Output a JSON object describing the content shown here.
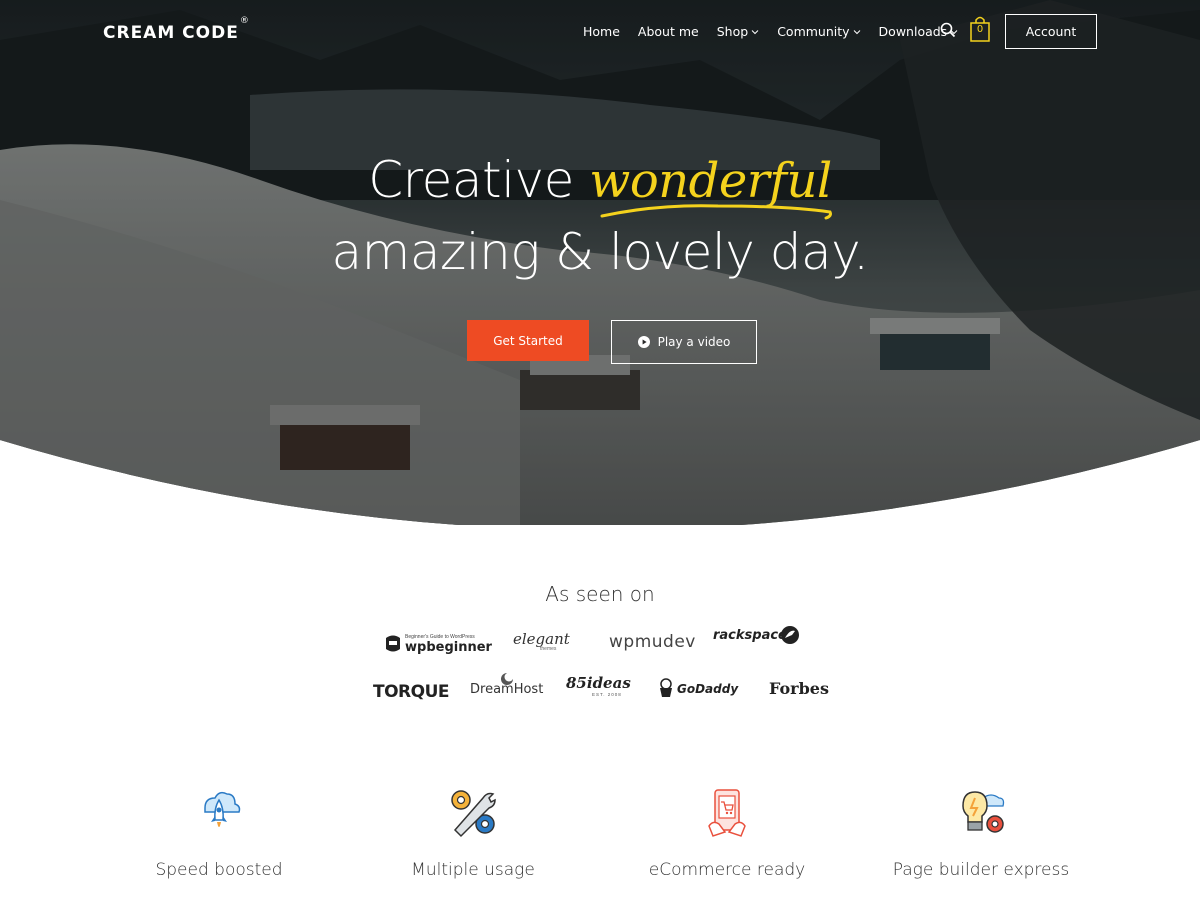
{
  "nav": {
    "logo": "CREAM CODE",
    "logo_mark": "®",
    "menu": [
      {
        "label": "Home",
        "dropdown": false
      },
      {
        "label": "About me",
        "dropdown": false
      },
      {
        "label": "Shop",
        "dropdown": true
      },
      {
        "label": "Community",
        "dropdown": true
      },
      {
        "label": "Downloads",
        "dropdown": true
      }
    ],
    "search_icon": "search-icon",
    "cart_icon": "shopping-bag-icon",
    "cart_count": "0",
    "account_label": "Account"
  },
  "hero": {
    "line1_prefix": "Creative",
    "line1_accent": "wonderful",
    "line2": "amazing & lovely day.",
    "primary_button": "Get Started",
    "video_button": "Play a video",
    "accent_color": "#f4d21d",
    "button_color": "#ee4b23"
  },
  "seen_on": {
    "title": "As seen on",
    "brands_row1": [
      "wpbeginner",
      "elegant",
      "wpmudev",
      "rackspace"
    ],
    "brands_row2": [
      "TORQUE",
      "DreamHost",
      "85ideas",
      "GoDaddy",
      "Forbes"
    ],
    "wpbeginner_tag": "Beginner's Guide to WordPress",
    "elegant_sub": "themes",
    "ideas_sub": "EST. 2008"
  },
  "features": [
    {
      "title": "Speed boosted",
      "icon": "rocket-cloud-icon"
    },
    {
      "title": "Multiple usage",
      "icon": "wrench-gears-icon"
    },
    {
      "title": "eCommerce ready",
      "icon": "mobile-shopping-icon"
    },
    {
      "title": "Page builder express",
      "icon": "lightbulb-gear-icon"
    }
  ]
}
